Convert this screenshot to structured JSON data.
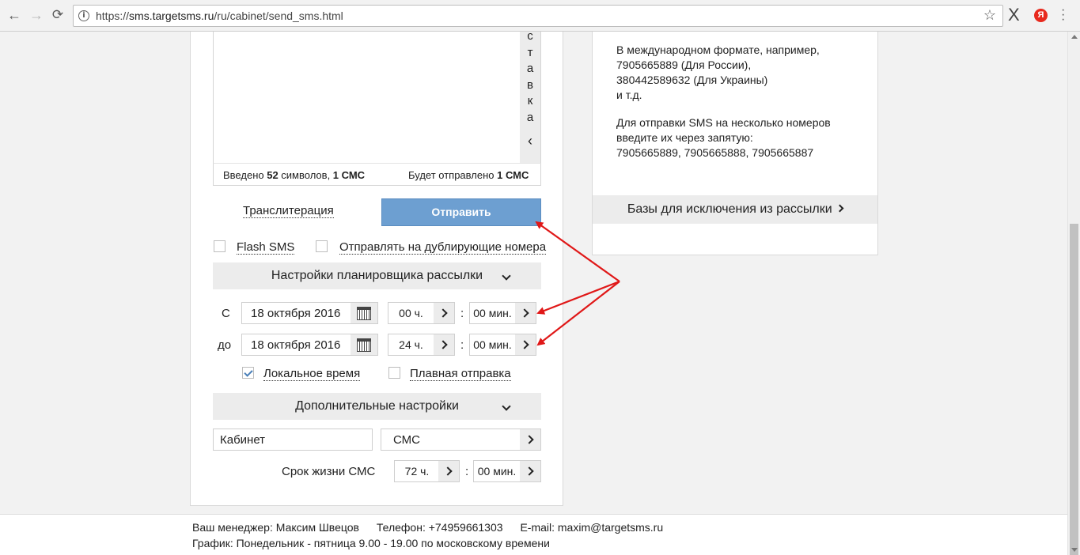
{
  "browser": {
    "url_prefix": "https://",
    "url_host": "sms.targetsms.ru",
    "url_path": "/ru/cabinet/send_sms.html",
    "back": "←",
    "forward": "→",
    "reload": "C",
    "star": "☆",
    "ext_x": "X",
    "ext_y": "Я"
  },
  "editor": {
    "vertical_tab_letters": [
      "с",
      "т",
      "а",
      "в",
      "к",
      "а"
    ],
    "vertical_tab_chevron": "‹",
    "counter_left_prefix": "Введено ",
    "counter_left_count": "52",
    "counter_left_mid": " символов, ",
    "counter_left_sms": "1 СМС",
    "counter_right_prefix": "Будет отправлено ",
    "counter_right_sms": "1 СМС"
  },
  "actions": {
    "transliteration": "Транслитерация",
    "send": "Отправить"
  },
  "options": {
    "flash_sms": "Flash SMS",
    "duplicate_numbers": "Отправлять на дублирующие номера"
  },
  "scheduler": {
    "title": "Настройки планировщика рассылки",
    "from_label": "С",
    "to_label": "до",
    "from_date": "18 октября 2016",
    "from_hours": "00 ч.",
    "from_minutes": "00 мин.",
    "to_date": "18 октября 2016",
    "to_hours": "24 ч.",
    "to_minutes": "00 мин.",
    "colon": ":",
    "local_time": "Локальное время",
    "local_time_checked": true,
    "smooth_send": "Плавная отправка",
    "smooth_send_checked": false
  },
  "additional": {
    "title": "Дополнительные настройки",
    "source": "Кабинет",
    "type": "СМС",
    "lifetime_label": "Срок жизни СМС",
    "lifetime_hours": "72 ч.",
    "lifetime_minutes": "00 мин.",
    "colon": ":"
  },
  "info": {
    "lines_1": [
      "В международном формате, например,",
      "7905665889 (Для России),",
      "380442589632 (Для Украины)",
      "и т.д."
    ],
    "lines_2": [
      "Для отправки SMS на несколько номеров",
      "введите их через запятую:",
      "7905665889, 7905665888, 7905665887"
    ],
    "exclude_bases": "Базы для исключения из рассылки"
  },
  "footer": {
    "manager": "Ваш менеджер: Максим Швецов",
    "phone": "Телефон: +74959661303",
    "email": "E-mail: maxim@targetsms.ru",
    "schedule": "График: Понедельник - пятница 9.00 - 19.00 по московскому времени"
  },
  "colors": {
    "send_button": "#6d9fd1",
    "annotation_arrows": "#e01818",
    "yandex_badge": "#e8291d"
  }
}
